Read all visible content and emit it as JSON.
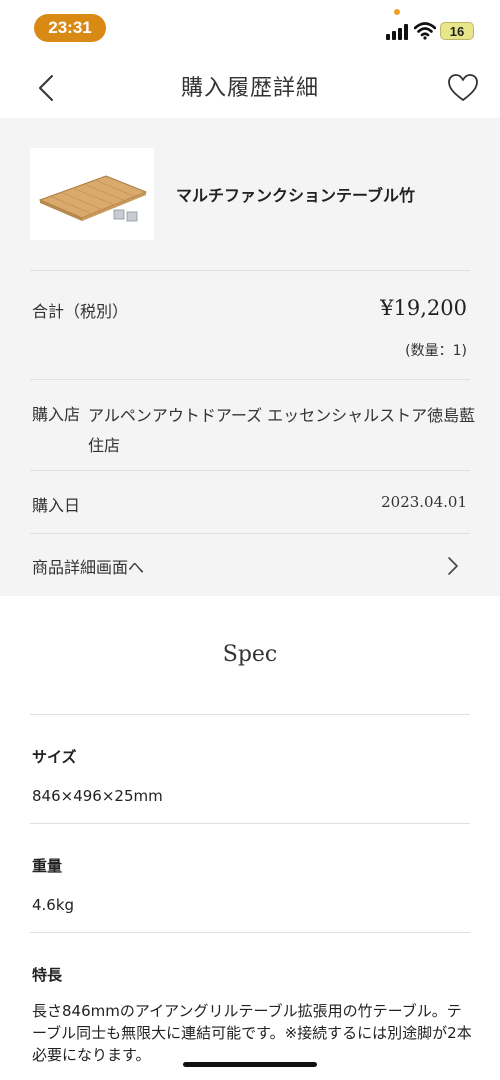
{
  "status_bar": {
    "time": "23:31",
    "battery": "16"
  },
  "nav": {
    "title": "購入履歴詳細",
    "back_icon": "chevron-left-icon",
    "favorite_icon": "heart-icon"
  },
  "product": {
    "name": "マルチファンクションテーブル竹"
  },
  "purchase": {
    "total_label": "合計（税別）",
    "total_price": "¥19,200",
    "quantity": "(数量：1)",
    "store_label": "購入店",
    "store_name": "アルペンアウトドアーズ エッセンシャルストア徳島藍住店",
    "date_label": "購入日",
    "date_value": "2023.04.01",
    "detail_link_label": "商品詳細画面へ"
  },
  "spec": {
    "title": "Spec",
    "size_label": "サイズ",
    "size_value": "846×496×25mm",
    "weight_label": "重量",
    "weight_value": "4.6kg",
    "feature_label": "特長",
    "feature_text": "長さ846mmのアイアングリルテーブル拡張用の竹テーブル。テーブル同士も無限大に連結可能です。※接続するには別途脚が2本必要になります。"
  },
  "colors": {
    "time_pill": "#d98a14",
    "section_bg": "#f4f4f4",
    "battery": "#e9e58a"
  }
}
